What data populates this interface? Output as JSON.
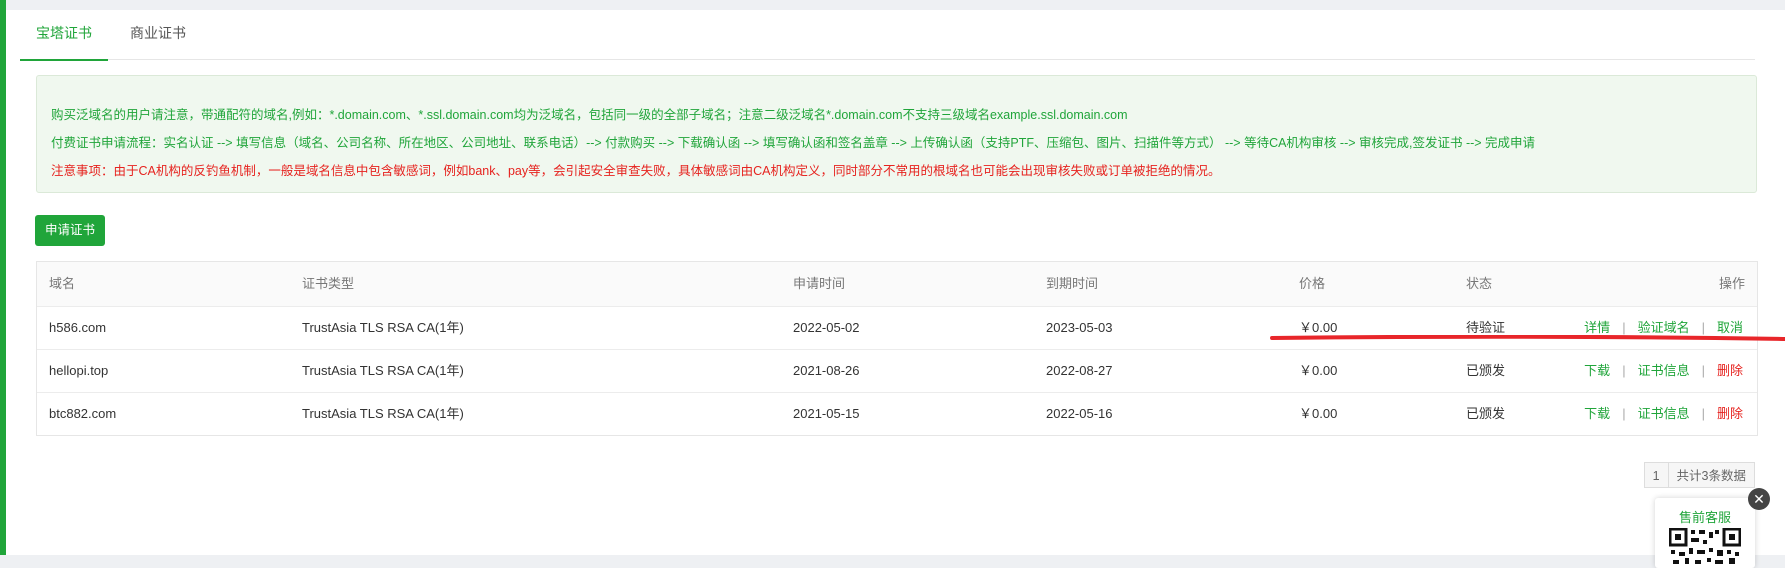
{
  "tabs": [
    {
      "label": "宝塔证书",
      "active": true
    },
    {
      "label": "商业证书",
      "active": false
    }
  ],
  "notice": {
    "line1": "购买泛域名的用户请注意，带通配符的域名,例如：*.domain.com、*.ssl.domain.com均为泛域名，包括同一级的全部子域名；注意二级泛域名*.domain.com不支持三级域名example.ssl.domain.com",
    "line2": "付费证书申请流程：实名认证 --> 填写信息（域名、公司名称、所在地区、公司地址、联系电话）--> 付款购买 --> 下载确认函 --> 填写确认函和签名盖章 --> 上传确认函（支持PTF、压缩包、图片、扫描件等方式） --> 等待CA机构审核 --> 审核完成,签发证书 --> 完成申请",
    "line3": "注意事项：由于CA机构的反钓鱼机制，一般是域名信息中包含敏感词，例如bank、pay等，会引起安全审查失败，具体敏感词由CA机构定义，同时部分不常用的根域名也可能会出现审核失败或订单被拒绝的情况。"
  },
  "apply_button": "申请证书",
  "table": {
    "headers": {
      "domain": "域名",
      "type": "证书类型",
      "apply_time": "申请时间",
      "expire_time": "到期时间",
      "price": "价格",
      "status": "状态",
      "ops": "操作"
    },
    "rows": [
      {
        "domain": "h586.com",
        "type": "TrustAsia TLS RSA CA(1年)",
        "apply_time": "2022-05-02",
        "expire_time": "2023-05-03",
        "price": "￥0.00",
        "status": "待验证",
        "ops": [
          {
            "label": "详情",
            "red": false
          },
          {
            "label": "验证域名",
            "red": false
          },
          {
            "label": "取消",
            "red": false
          }
        ]
      },
      {
        "domain": "hellopi.top",
        "type": "TrustAsia TLS RSA CA(1年)",
        "apply_time": "2021-08-26",
        "expire_time": "2022-08-27",
        "price": "￥0.00",
        "status": "已颁发",
        "ops": [
          {
            "label": "下载",
            "red": false
          },
          {
            "label": "证书信息",
            "red": false
          },
          {
            "label": "删除",
            "red": true
          }
        ]
      },
      {
        "domain": "btc882.com",
        "type": "TrustAsia TLS RSA CA(1年)",
        "apply_time": "2021-05-15",
        "expire_time": "2022-05-16",
        "price": "￥0.00",
        "status": "已颁发",
        "ops": [
          {
            "label": "下载",
            "red": false
          },
          {
            "label": "证书信息",
            "red": false
          },
          {
            "label": "删除",
            "red": true
          }
        ]
      }
    ]
  },
  "pagination": {
    "page": "1",
    "total": "共计3条数据"
  },
  "customer_service": {
    "title": "售前客服",
    "close_icon": "close-icon",
    "qr_icon": "qr-code-icon"
  },
  "colors": {
    "accent": "#20a53a",
    "danger": "#e6231f"
  }
}
